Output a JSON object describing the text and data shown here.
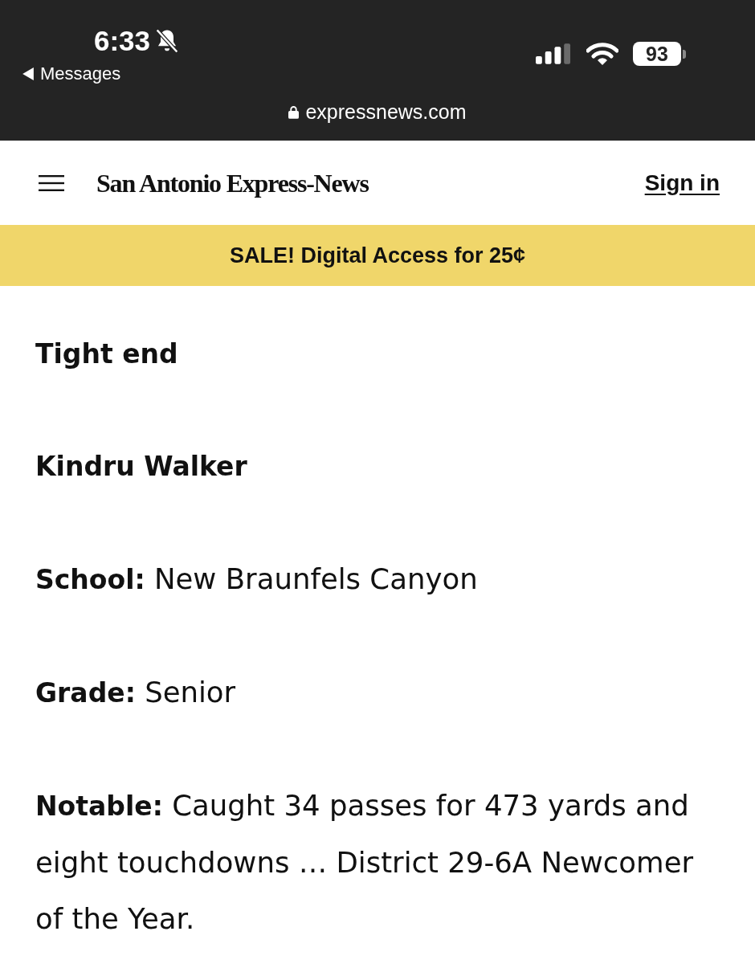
{
  "status_bar": {
    "time": "6:33",
    "back_label": "Messages",
    "battery": "93",
    "url": "expressnews.com"
  },
  "header": {
    "logo": "San Antonio Express-News",
    "sign_in": "Sign in"
  },
  "promo_banner": {
    "text": "SALE! Digital Access for 25¢"
  },
  "article": {
    "paragraphs": [
      {
        "kind": "heading",
        "text": "Tight end"
      },
      {
        "kind": "heading",
        "text": "Kindru Walker"
      },
      {
        "kind": "fact",
        "text": "**School:** New Braunfels Canyon"
      },
      {
        "kind": "fact",
        "text": "**Grade:** Senior"
      },
      {
        "kind": "fact",
        "text": "**Notable:** Caught 34 passes for 473 yards and eight touchdowns … District 29-6A Newcomer of the Year."
      }
    ]
  }
}
